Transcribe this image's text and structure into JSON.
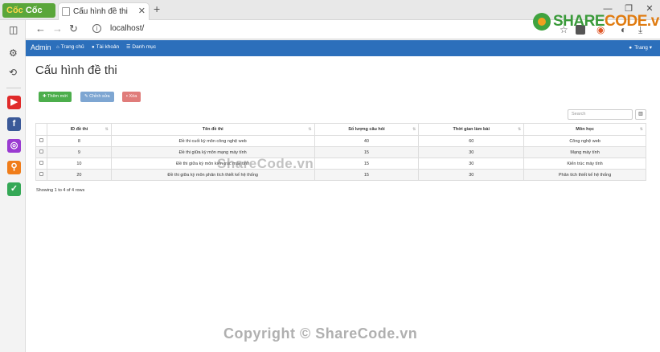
{
  "browser": {
    "logo_label_a": "Cốc",
    "logo_label_b": "Cốc",
    "tab_title": "Cấu hình đề thi",
    "tab_close": "✕",
    "new_tab": "+",
    "win_min": "—",
    "win_max": "❐",
    "win_close": "✕",
    "url": "localhost/",
    "url_info": "i"
  },
  "sharecode_logo": {
    "share": "SHARE",
    "code": "CODE.vn"
  },
  "navbar": {
    "brand": "Admin",
    "items": [
      {
        "label": "Trang chủ",
        "icon": "home-icon"
      },
      {
        "label": "Tài khoản",
        "icon": "user-icon"
      },
      {
        "label": "Danh mục",
        "icon": "list-icon"
      }
    ],
    "user": "Trang ▾"
  },
  "page": {
    "title": "Cấu hình đề thi",
    "buttons": {
      "add": "Thêm mới",
      "edit": "Chỉnh sửa",
      "delete": "Xóa"
    },
    "search_placeholder": "Search",
    "table": {
      "headers": [
        "ID đề thi",
        "Tên đề thi",
        "Số lượng câu hỏi",
        "Thời gian làm bài",
        "Môn học"
      ],
      "rows": [
        [
          "8",
          "Đề thi cuối kỳ môn công nghệ web",
          "40",
          "60",
          "Công nghệ web"
        ],
        [
          "9",
          "Đề thi giữa kỳ môn mạng máy tính",
          "15",
          "30",
          "Mạng máy tính"
        ],
        [
          "10",
          "Đề thi giữa kỳ môn kiến trúc máy tính",
          "15",
          "30",
          "Kiến trúc máy tính"
        ],
        [
          "20",
          "Đề thi giữa kỳ môn phân tích thiết kế hệ thống",
          "15",
          "30",
          "Phân tích thiết kế hệ thống"
        ]
      ]
    },
    "pagination_text": "Showing 1 to 4 of 4 rows"
  },
  "watermarks": {
    "middle": "ShareCode.vn",
    "bottom": "Copyright © ShareCode.vn"
  },
  "colors": {
    "navbar": "#2c6fbb",
    "add_button": "#4cae4c",
    "edit_button": "#7ea6d2",
    "delete_button": "#e07c7a"
  }
}
